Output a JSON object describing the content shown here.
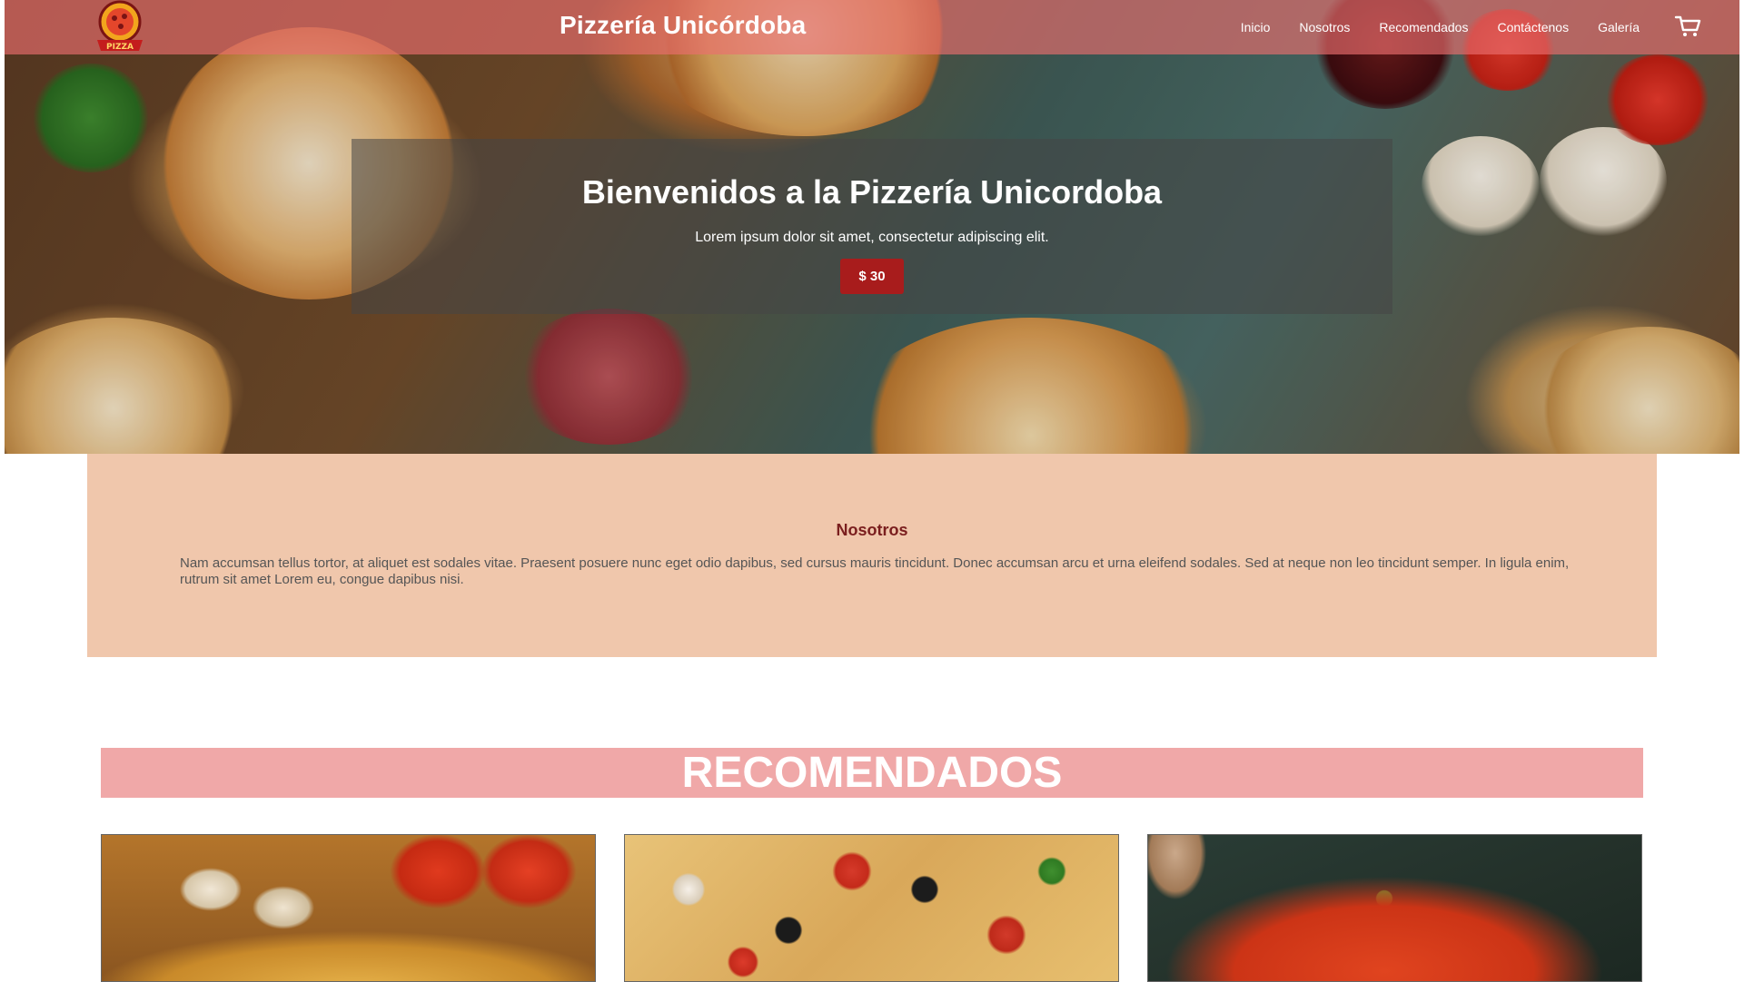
{
  "header": {
    "site_title": "Pizzería Unicórdoba",
    "logo_text": "PIZZA",
    "nav": [
      {
        "label": "Inicio"
      },
      {
        "label": "Nosotros"
      },
      {
        "label": "Recomendados"
      },
      {
        "label": "Contáctenos"
      },
      {
        "label": "Galería"
      }
    ],
    "cart_icon": "cart-icon",
    "bar_color": "#eb6e6e"
  },
  "hero": {
    "title": "Bienvenidos a la Pizzería Unicordoba",
    "subtitle": "Lorem ipsum dolor sit amet, consectetur adipiscing elit.",
    "price_button": "$ 30",
    "button_color": "#a81c1c"
  },
  "about": {
    "title": "Nosotros",
    "text": "Nam accumsan tellus tortor, at aliquet est sodales vitae. Praesent posuere nunc eget odio dapibus, sed cursus mauris tincidunt. Donec accumsan arcu et urna eleifend sodales. Sed at neque non leo tincidunt semper. In ligula enim, rutrum sit amet Lorem eu, congue dapibus nisi.",
    "background": "#f0c7ac"
  },
  "recommended": {
    "title": "RECOMENDADOS",
    "band_color": "#f0a8a8",
    "cards": [
      {
        "image": "pizza-mushroom-tomato"
      },
      {
        "image": "pizza-olives-peppers"
      },
      {
        "image": "pizza-pepperoni-peppers"
      }
    ]
  }
}
